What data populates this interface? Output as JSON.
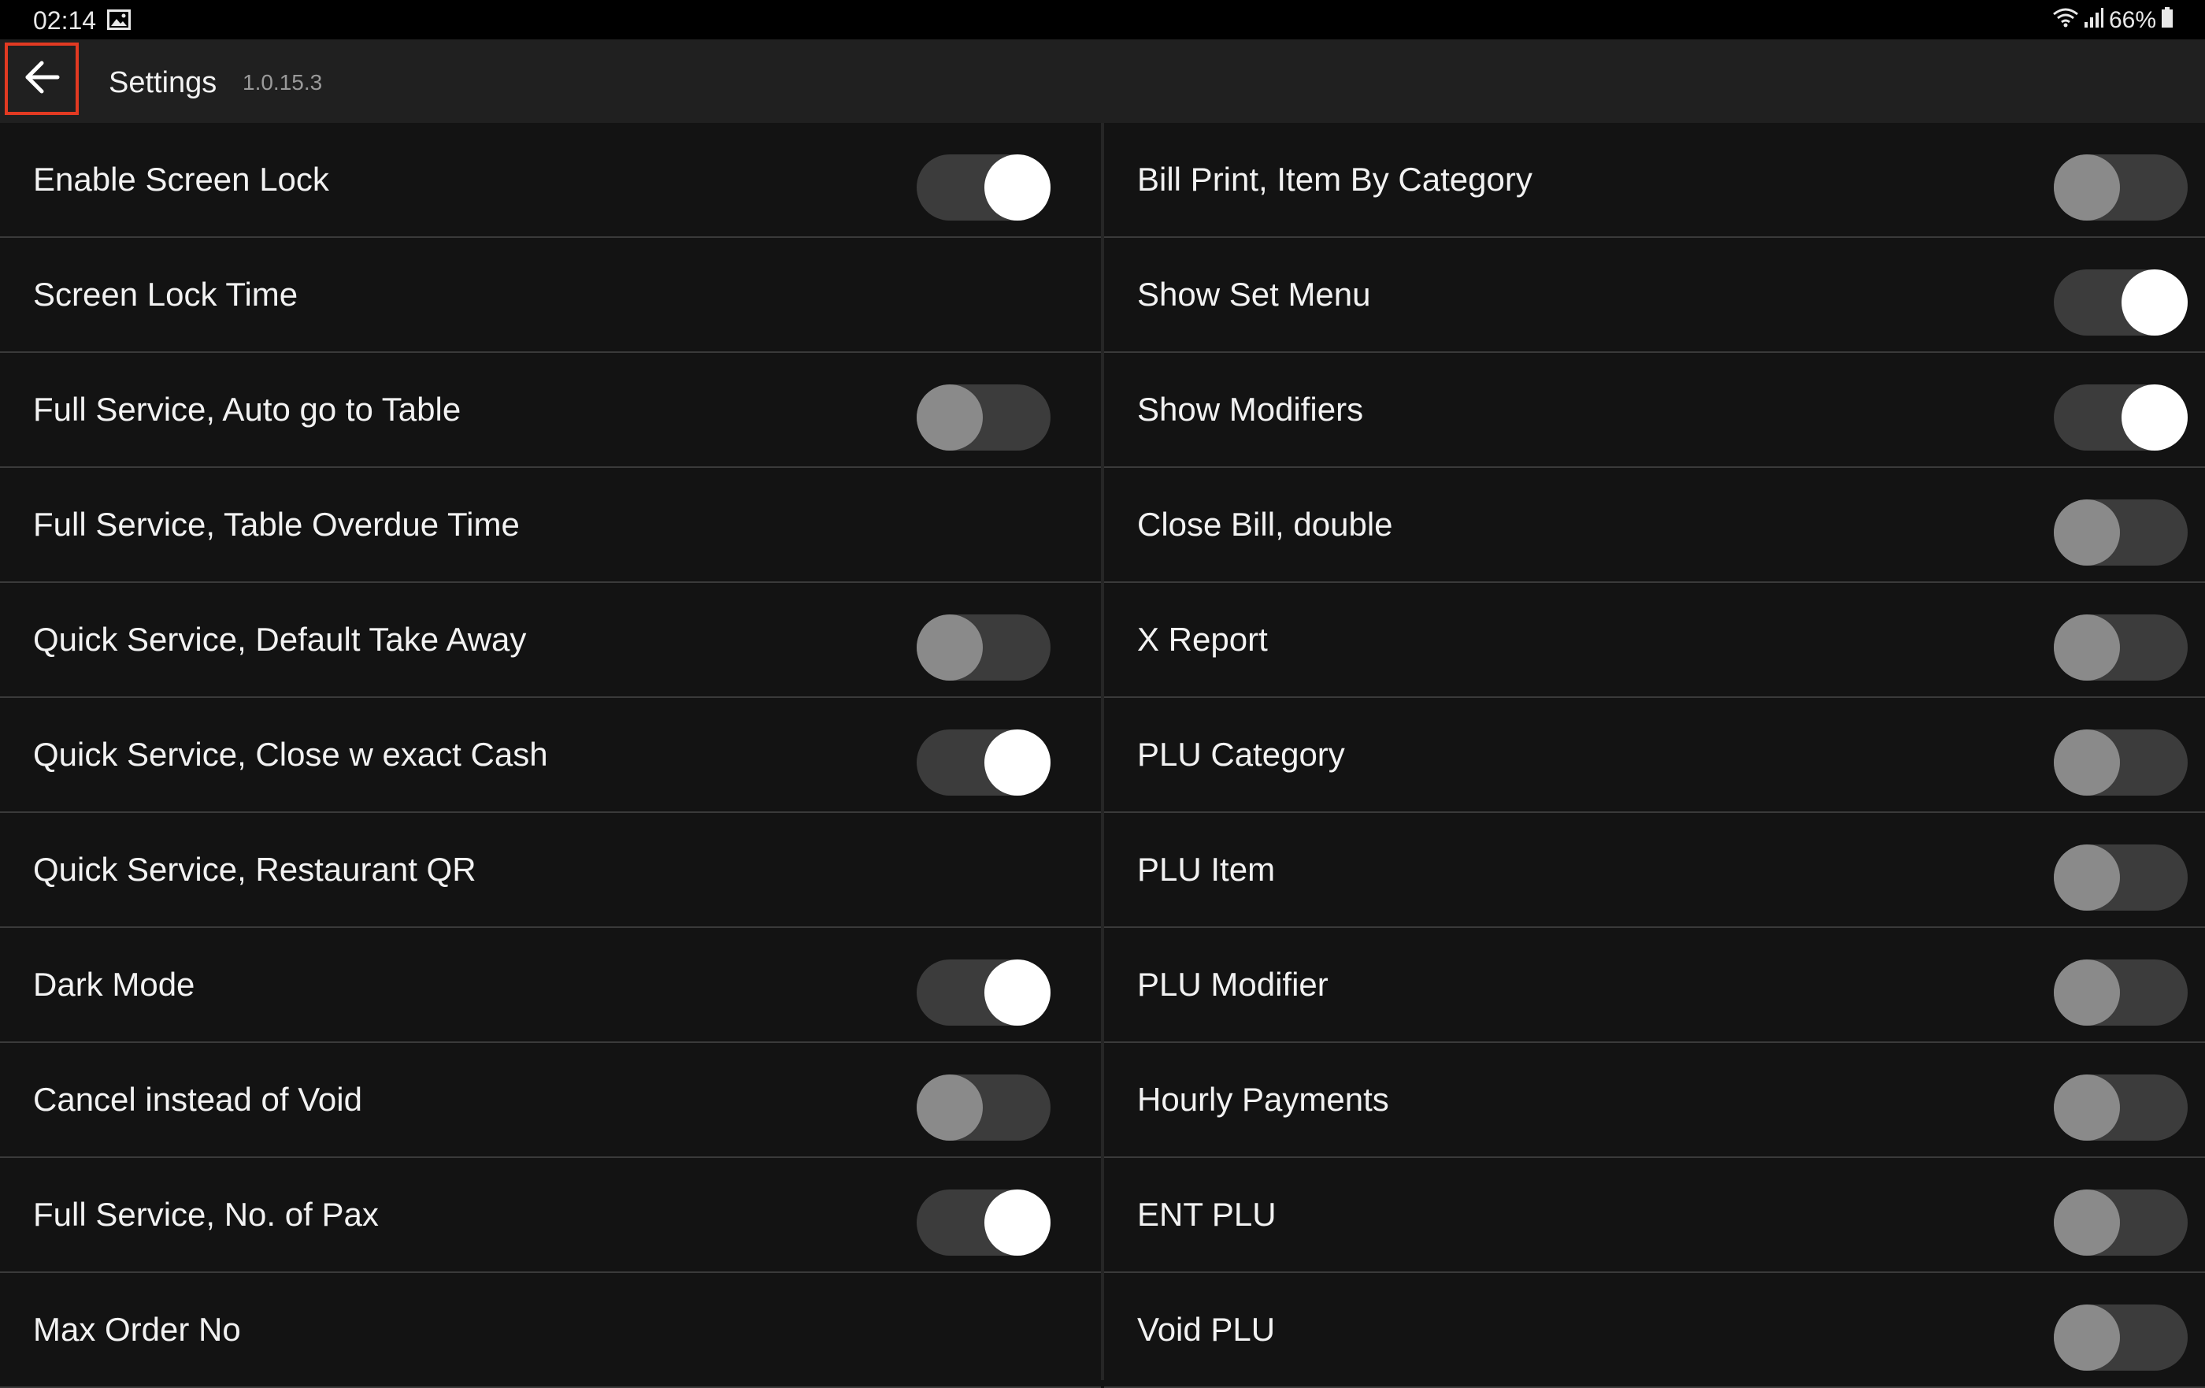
{
  "status_bar": {
    "time": "02:14",
    "battery": "66%",
    "icons": [
      "image-icon",
      "wifi-icon",
      "signal-icon",
      "battery-icon"
    ]
  },
  "app_bar": {
    "title": "Settings",
    "version": "1.0.15.3",
    "back_icon": "arrow-left-icon",
    "highlight_color": "#e23a22"
  },
  "settings": {
    "left": [
      {
        "label": "Enable Screen Lock",
        "toggle": true,
        "on": true
      },
      {
        "label": "Screen Lock Time",
        "toggle": false
      },
      {
        "label": "Full Service, Auto go to Table",
        "toggle": true,
        "on": false
      },
      {
        "label": "Full Service, Table Overdue Time",
        "toggle": false
      },
      {
        "label": "Quick Service, Default Take Away",
        "toggle": true,
        "on": false
      },
      {
        "label": "Quick Service, Close w exact Cash",
        "toggle": true,
        "on": true
      },
      {
        "label": "Quick Service, Restaurant QR",
        "toggle": false
      },
      {
        "label": "Dark Mode",
        "toggle": true,
        "on": true
      },
      {
        "label": "Cancel instead of Void",
        "toggle": true,
        "on": false
      },
      {
        "label": "Full Service, No. of Pax",
        "toggle": true,
        "on": true
      },
      {
        "label": "Max Order No",
        "toggle": false
      }
    ],
    "right": [
      {
        "label": "Bill Print, Item By Category",
        "toggle": true,
        "on": false
      },
      {
        "label": "Show Set Menu",
        "toggle": true,
        "on": true
      },
      {
        "label": "Show Modifiers",
        "toggle": true,
        "on": true
      },
      {
        "label": "Close Bill, double",
        "toggle": true,
        "on": false
      },
      {
        "label": "X Report",
        "toggle": true,
        "on": false
      },
      {
        "label": "PLU Category",
        "toggle": true,
        "on": false
      },
      {
        "label": "PLU Item",
        "toggle": true,
        "on": false
      },
      {
        "label": "PLU Modifier",
        "toggle": true,
        "on": false
      },
      {
        "label": "Hourly Payments",
        "toggle": true,
        "on": false
      },
      {
        "label": "ENT PLU",
        "toggle": true,
        "on": false
      },
      {
        "label": "Void PLU",
        "toggle": true,
        "on": false
      }
    ]
  },
  "colors": {
    "background": "#131313",
    "app_bar": "#202020",
    "divider": "#3a3a3a",
    "toggle_track": "#3c3c3c",
    "toggle_knob_on": "#ffffff",
    "toggle_knob_off": "#8a8a8a"
  }
}
